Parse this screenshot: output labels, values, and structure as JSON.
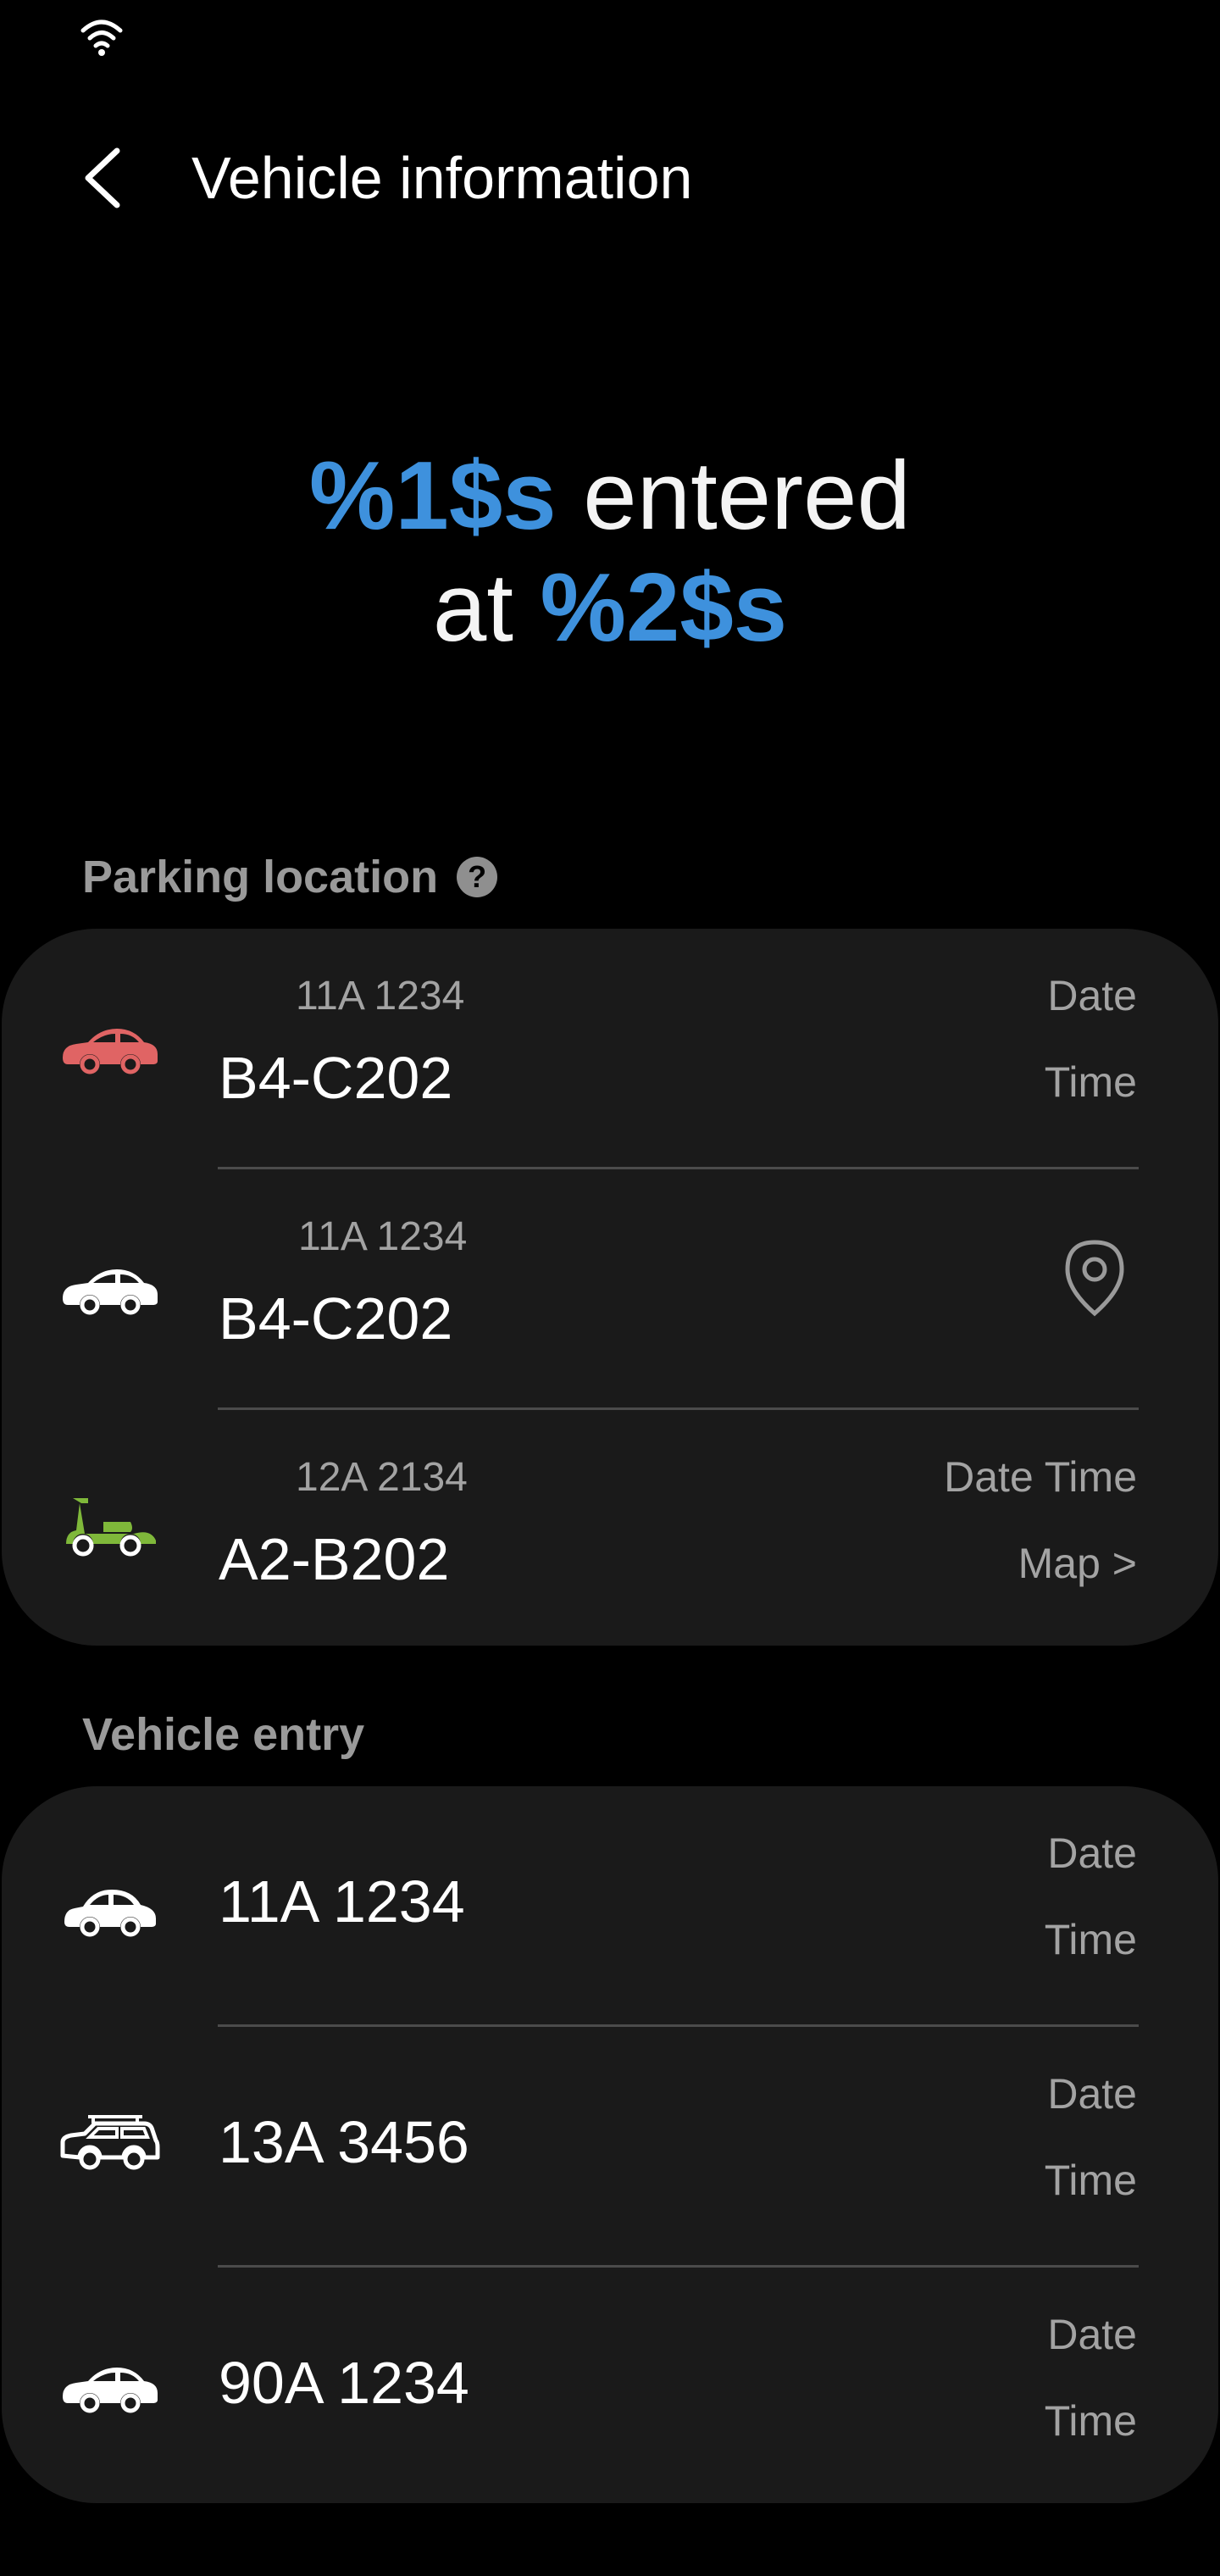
{
  "status_bar": {
    "wifi_icon": "wifi-icon"
  },
  "app_bar": {
    "title": "Vehicle information",
    "back_icon": "back-arrow-icon"
  },
  "hero": {
    "placeholder_1": "%1$s",
    "text_1": " entered",
    "text_2": "at ",
    "placeholder_2": "%2$s"
  },
  "parking_section": {
    "title": "Parking location",
    "help_icon": "?",
    "items": [
      {
        "icon": "red-sedan-icon",
        "plate": "11A 1234",
        "location": "B4-C202",
        "right_top": "Date",
        "right_bottom": "Time"
      },
      {
        "icon": "white-sedan-icon",
        "plate": "11A 1234",
        "location": "B4-C202",
        "right_icon": "location-pin-icon"
      },
      {
        "icon": "green-scooter-icon",
        "plate": "12A 2134",
        "location": "A2-B202",
        "right_top": "Date Time",
        "right_bottom": "Map >"
      }
    ]
  },
  "entry_section": {
    "title": "Vehicle entry",
    "items": [
      {
        "icon": "white-hatchback-icon",
        "plate": "11A 1234",
        "right_top": "Date",
        "right_bottom": "Time"
      },
      {
        "icon": "suv-icon",
        "plate": "13A 3456",
        "right_top": "Date",
        "right_bottom": "Time"
      },
      {
        "icon": "white-sedan-icon",
        "plate": "90A 1234",
        "right_top": "Date",
        "right_bottom": "Time"
      }
    ]
  },
  "colors": {
    "background": "#000000",
    "card": "#1a1a1a",
    "accent": "#3e91dd",
    "red_car": "#e06464",
    "green_scooter": "#7fb83a",
    "secondary_text": "#a3a3a3"
  }
}
